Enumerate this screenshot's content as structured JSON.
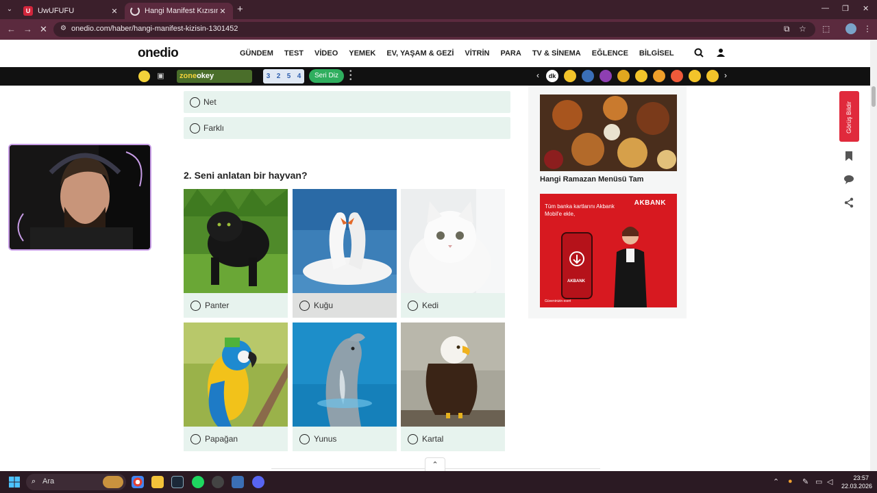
{
  "browser": {
    "tabs": [
      {
        "title": "UwUFUFU",
        "favicon_letter": "U"
      },
      {
        "title": "Hangi Manifest Kızısın? - Onedio"
      }
    ],
    "url": "onedio.com/haber/hangi-manifest-kizisin-1301452"
  },
  "site": {
    "logo": "onedio",
    "nav": [
      "GÜNDEM",
      "TEST",
      "VİDEO",
      "YEMEK",
      "EV, YAŞAM & GEZİ",
      "VİTRİN",
      "PARA",
      "TV & SİNEMA",
      "EĞLENCE",
      "BİLGİSEL"
    ],
    "subbar": {
      "zone_prefix": "zone",
      "zone_suffix": "okey",
      "tiles": [
        "3",
        "2",
        "5",
        "4"
      ],
      "seri_diz": "Seri Diz",
      "dk_label": "dk"
    }
  },
  "quiz": {
    "prev_options": [
      "Net",
      "Farklı"
    ],
    "question": "2. Seni anlatan bir hayvan?",
    "options": [
      "Panter",
      "Kuğu",
      "Kedi",
      "Papağan",
      "Yunus",
      "Kartal"
    ]
  },
  "sidebar": {
    "ad1_caption": "Hangi Ramazan Menüsü Tam",
    "ad2": {
      "brand": "AKBANK",
      "text": "Tüm banka kartlarını Akbank Mobil'e ekle,",
      "small": "Güveninizin eseri",
      "phone_brand": "AKBANK"
    },
    "feedback": "Görüş Bildir"
  },
  "taskbar": {
    "search": "Ara",
    "time": "23:57",
    "date": "22.03.2026"
  },
  "colors": {
    "tab_bg": "#3b1f2b",
    "toolbar_bg": "#5b2a3e",
    "option_bg": "#e7f3ee",
    "accent_red": "#e02a3c",
    "akbank_red": "#d71920",
    "seri_diz_green": "#2fae5e"
  }
}
